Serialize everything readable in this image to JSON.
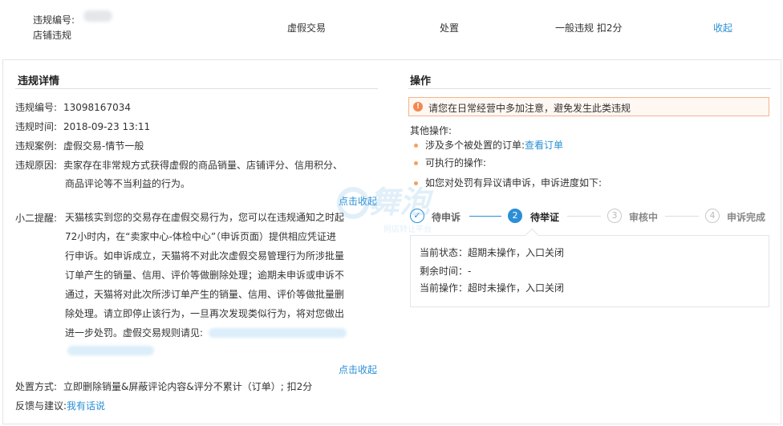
{
  "header": {
    "id_label": "违规编号:",
    "type_label": "店铺违规",
    "category": "虚假交易",
    "action": "处置",
    "penalty": "一般违规 扣2分",
    "collapse": "收起"
  },
  "details": {
    "title": "违规详情",
    "number_label": "违规编号:",
    "number_value": "13098167034",
    "time_label": "违规时间:",
    "time_value": "2018-09-23 13:11",
    "case_label": "违规案例:",
    "case_value": "虚假交易-情节一般",
    "reason_label": "违规原因:",
    "reason_line1": "卖家存在非常规方式获得虚假的商品销量、店铺评分、信用积分、",
    "reason_line2": "商品评论等不当利益的行为。",
    "fold_link_1": "点击收起",
    "tip_label": "小二提醒:",
    "tip_lines": [
      "天猫核实到您的交易存在虚假交易行为，您可以在违规通知之时起",
      "72小时内，在“卖家中心-体检中心”（申诉页面）提供相应凭证进",
      "行申诉。如申诉成立，天猫将不对此次虚假交易管理行为所涉批量",
      "订单产生的销量、信用、评价等做删除处理；逾期未申诉或申诉不",
      "通过，天猫将对此次所涉订单产生的销量、信用、评价等做批量删",
      "除处理。请立即停止该行为，一旦再次发现类似行为，将对您做出",
      "进一步处罚。虚假交易规则请见:"
    ],
    "fold_link_2": "点击收起",
    "method_label": "处置方式:",
    "method_value": "立即删除销量&屏蔽评论内容&评分不累计（订单）; 扣2分",
    "feedback_label": "反馈与建议:",
    "feedback_link": "我有话说"
  },
  "operation": {
    "title": "操作",
    "notice": "请您在日常经营中多加注意，避免发生此类违规",
    "other_ops": "其他操作:",
    "item1_text": "涉及多个被处置的订单:",
    "item1_link": "查看订单",
    "item2_text": "可执行的操作:",
    "item3_text": "如您对处罚有异议请申诉，申诉进度如下:",
    "steps": [
      {
        "num": "✓",
        "label": "待申诉",
        "state": "done"
      },
      {
        "num": "2",
        "label": "待举证",
        "state": "active"
      },
      {
        "num": "3",
        "label": "审核中",
        "state": "idle"
      },
      {
        "num": "4",
        "label": "申诉完成",
        "state": "idle"
      }
    ],
    "status_line1": "当前状态：超期未操作，入口关闭",
    "status_line2": "剩余时间：-",
    "status_line3": "当前操作：超时未操作，入口关闭"
  },
  "watermark": {
    "big": "舞泡",
    "small": "网店转让平台"
  },
  "colors": {
    "link": "#2a8fd6",
    "notice_border": "#f5b48c",
    "notice_icon": "#f5874f",
    "bullet": "#f5a15f"
  }
}
